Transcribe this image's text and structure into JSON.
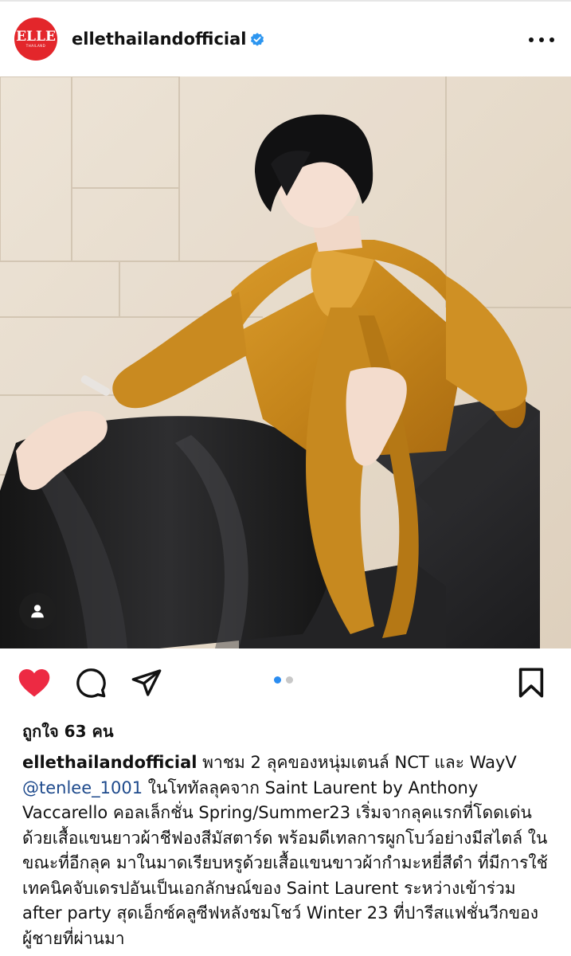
{
  "header": {
    "avatar_logo": "ELLE",
    "avatar_logo_sub": "THAILAND",
    "username": "ellethailandofficial",
    "verified_icon": "verified-badge-icon",
    "more_icon": "more-dots-icon"
  },
  "photo": {
    "tag_icon": "user-tag-icon"
  },
  "actions": {
    "like_icon": "heart-filled-icon",
    "comment_icon": "comment-icon",
    "share_icon": "send-icon",
    "save_icon": "bookmark-icon",
    "carousel_index": 1,
    "carousel_total": 2
  },
  "likes_text": "ถูกใจ 63 คน",
  "caption": {
    "username": "ellethailandofficial",
    "text_1": " พาชม 2 ลุคของหนุ่มเตนล์ NCT และ WayV ",
    "mention": "@tenlee_1001",
    "text_2": " ในโททัลลุคจาก Saint Laurent by Anthony Vaccarello คอลเล็กชั่น Spring/Summer23 เริ่มจากลุคแรกที่โดดเด่นด้วยเสื้อแขนยาวผ้าชีฟองสีมัสตาร์ด พร้อมดีเทลการผูกโบว์อย่างมีสไตล์ ในขณะที่อีกลุค มาในมาดเรียบหรูด้วยเสื้อแขนขาวผ้ากำมะหยี่สีดำ ที่มีการใช้เทคนิคจับเดรปอันเป็นเอกลักษณ์ของ Saint Laurent ระหว่างเข้าร่วม after party สุดเอ็กซ์คลูซีฟหลังชมโชว์ Winter 23 ที่ปารีสแฟชั่นวีกของผู้ชายที่ผ่านมา"
  },
  "colors": {
    "like_red": "#ed2a43",
    "carousel_active": "#2a8cf0",
    "verified_blue": "#2d96f0",
    "brand_red": "#e3262b"
  }
}
